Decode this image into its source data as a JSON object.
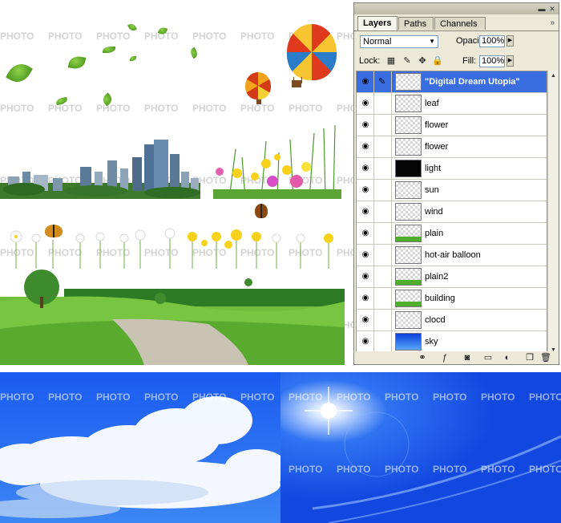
{
  "watermark": {
    "text": "PHOTO"
  },
  "colors": {
    "sky_blue": "#1a5bf0",
    "grass_green": "#5bb832",
    "selection_blue": "#3a6ee0"
  },
  "layers_panel": {
    "tabs": [
      {
        "label": "Layers",
        "active": true
      },
      {
        "label": "Paths",
        "active": false
      },
      {
        "label": "Channels",
        "active": false
      }
    ],
    "menu_icon": "double-chevron-right",
    "blend_mode": "Normal",
    "opacity_label": "Opacity:",
    "opacity_value": "100%",
    "lock_label": "Lock:",
    "fill_label": "Fill:",
    "fill_value": "100%",
    "lock_icons": [
      "lock-transparency-icon",
      "lock-image-icon",
      "lock-position-icon",
      "lock-all-icon"
    ],
    "layers": [
      {
        "name": "\"Digital Dream Utopia\"",
        "selected": true,
        "visible": true,
        "thumb": "checker"
      },
      {
        "name": "leaf",
        "selected": false,
        "visible": true,
        "thumb": "checker"
      },
      {
        "name": "flower",
        "selected": false,
        "visible": true,
        "thumb": "checker"
      },
      {
        "name": "flower",
        "selected": false,
        "visible": true,
        "thumb": "checker"
      },
      {
        "name": "light",
        "selected": false,
        "visible": true,
        "thumb": "dark"
      },
      {
        "name": "sun",
        "selected": false,
        "visible": true,
        "thumb": "checker"
      },
      {
        "name": "wind",
        "selected": false,
        "visible": true,
        "thumb": "checker"
      },
      {
        "name": "plain",
        "selected": false,
        "visible": true,
        "thumb": "green"
      },
      {
        "name": "hot-air balloon",
        "selected": false,
        "visible": true,
        "thumb": "checker"
      },
      {
        "name": "plain2",
        "selected": false,
        "visible": true,
        "thumb": "green"
      },
      {
        "name": "building",
        "selected": false,
        "visible": true,
        "thumb": "green"
      },
      {
        "name": "clocd",
        "selected": false,
        "visible": true,
        "thumb": "checker"
      },
      {
        "name": "sky",
        "selected": false,
        "visible": true,
        "thumb": "blue"
      }
    ],
    "footer_icons": [
      "link-layers-icon",
      "layer-style-icon",
      "layer-mask-icon",
      "new-group-icon",
      "adjustment-layer-icon",
      "new-layer-icon",
      "trash-icon"
    ]
  }
}
